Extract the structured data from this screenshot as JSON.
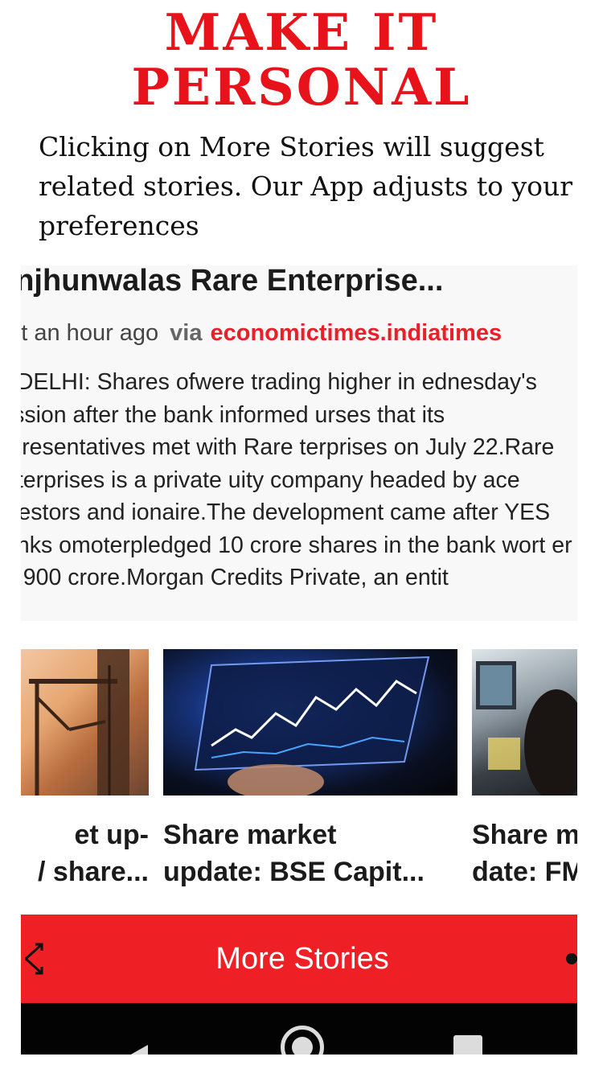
{
  "promo": {
    "headline_line1": "MAKE IT",
    "headline_line2": "PERSONAL",
    "description": "Clicking on More Stories will suggest related stories. Our App adjusts to your preferences"
  },
  "article": {
    "title": "unjhunwalas Rare Enterprise...",
    "time": "out an hour ago",
    "via_label": "via",
    "source": "economictimes.indiatimes",
    "body": "W DELHI: Shares ofwere trading higher in ednesday's session after the bank informed urses that its representatives met with Rare terprises on July 22.Rare Enterprises is a private uity company headed by ace investors and ionaire.The development came after YES Banks omoterpledged 10 crore shares in the bank wort er Rs 900 crore.Morgan Credits Private, an entit"
  },
  "related_stories": [
    {
      "title_line1": "et up-",
      "title_line2": "/ share...",
      "image": "construction-crane"
    },
    {
      "title_line1": "Share market",
      "title_line2": "update: BSE Capit...",
      "image": "stock-chart-tablet"
    },
    {
      "title_line1": "Share m",
      "title_line2": "date: FM",
      "image": "trader-screens"
    }
  ],
  "more_stories": {
    "label": "More Stories",
    "left_icon": "shuffle-icon",
    "right_icon": "dot-icon",
    "color": "#ee1f25"
  },
  "navbar": {
    "buttons": [
      "back-icon",
      "home-icon",
      "recent-apps-icon"
    ]
  },
  "colors": {
    "headline": "#e8131a",
    "source_link": "#e8202a",
    "accent": "#ee1f25"
  }
}
